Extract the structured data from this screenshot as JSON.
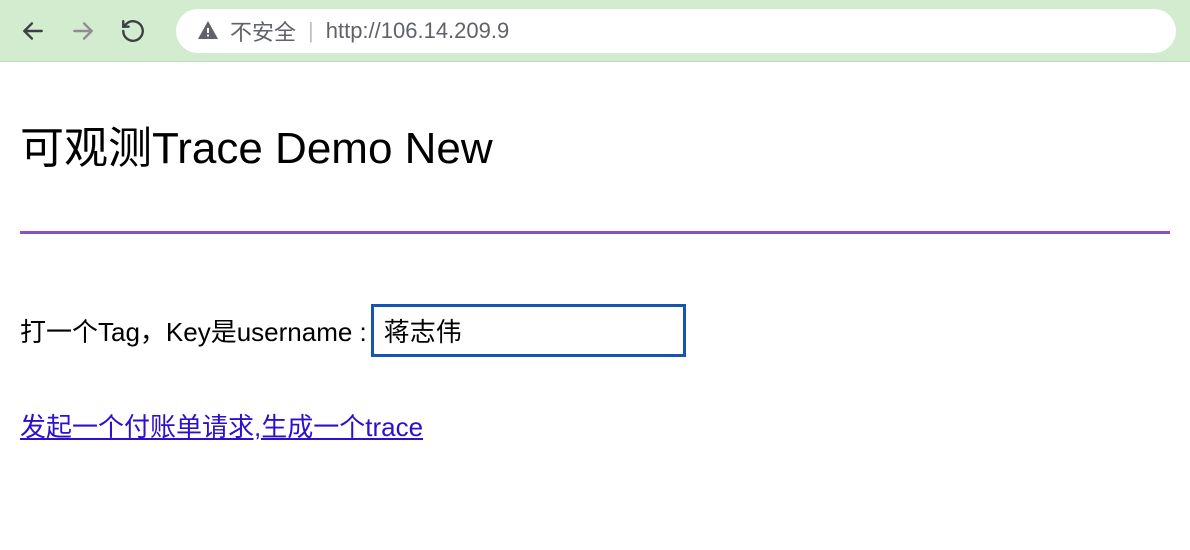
{
  "toolbar": {
    "security_label": "不安全",
    "url": "http://106.14.209.9"
  },
  "page": {
    "title": "可观测Trace Demo New",
    "form_label": "打一个Tag，Key是username :",
    "input_value": "蒋志伟",
    "link_text": "发起一个付账单请求,生成一个trace"
  }
}
